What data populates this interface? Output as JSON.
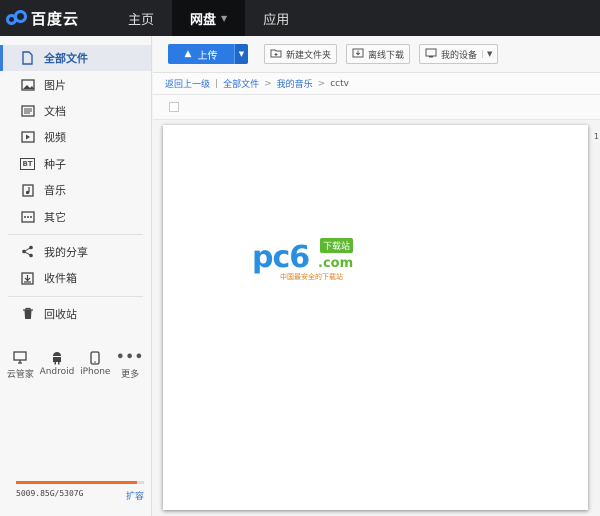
{
  "app": {
    "logo_text": "百度云",
    "nav": [
      {
        "label": "主页"
      },
      {
        "label": "网盘",
        "active": true
      },
      {
        "label": "应用"
      }
    ]
  },
  "sidebar": {
    "items": [
      {
        "label": "全部文件",
        "icon": "document-icon",
        "active": true
      },
      {
        "label": "图片",
        "icon": "image-icon"
      },
      {
        "label": "文档",
        "icon": "doc-icon"
      },
      {
        "label": "视频",
        "icon": "video-icon"
      },
      {
        "label": "种子",
        "icon": "bt-icon",
        "icon_text": "BT"
      },
      {
        "label": "音乐",
        "icon": "music-icon"
      },
      {
        "label": "其它",
        "icon": "more-icon"
      }
    ],
    "share_items": [
      {
        "label": "我的分享",
        "icon": "share-icon"
      },
      {
        "label": "收件箱",
        "icon": "inbox-icon"
      }
    ],
    "trash": {
      "label": "回收站",
      "icon": "trash-icon"
    },
    "devices": [
      {
        "label": "云管家",
        "icon": "monitor-icon"
      },
      {
        "label": "Android",
        "icon": "android-icon"
      },
      {
        "label": "iPhone",
        "icon": "phone-icon"
      },
      {
        "label": "更多",
        "icon": "more-dots-icon"
      }
    ],
    "quota": {
      "text": "5009.85G/5307G",
      "expand_label": "扩容",
      "fill_fraction": 0.944
    }
  },
  "toolbar": {
    "upload_label": "上传",
    "new_folder_label": "新建文件夹",
    "offline_download_label": "离线下载",
    "my_devices_label": "我的设备"
  },
  "breadcrumb": {
    "back": "返回上一级",
    "items": [
      "全部文件",
      "我的音乐"
    ],
    "current": "cctv"
  },
  "watermark": {
    "brand": "pc6",
    "domain": ".com",
    "tag": "下载站",
    "slogan": "中国最安全的下载站"
  },
  "side_mark": "1",
  "colors": {
    "accent": "#2c7be5",
    "topbar": "#222326",
    "quota_fill": "#ef6c2a"
  }
}
